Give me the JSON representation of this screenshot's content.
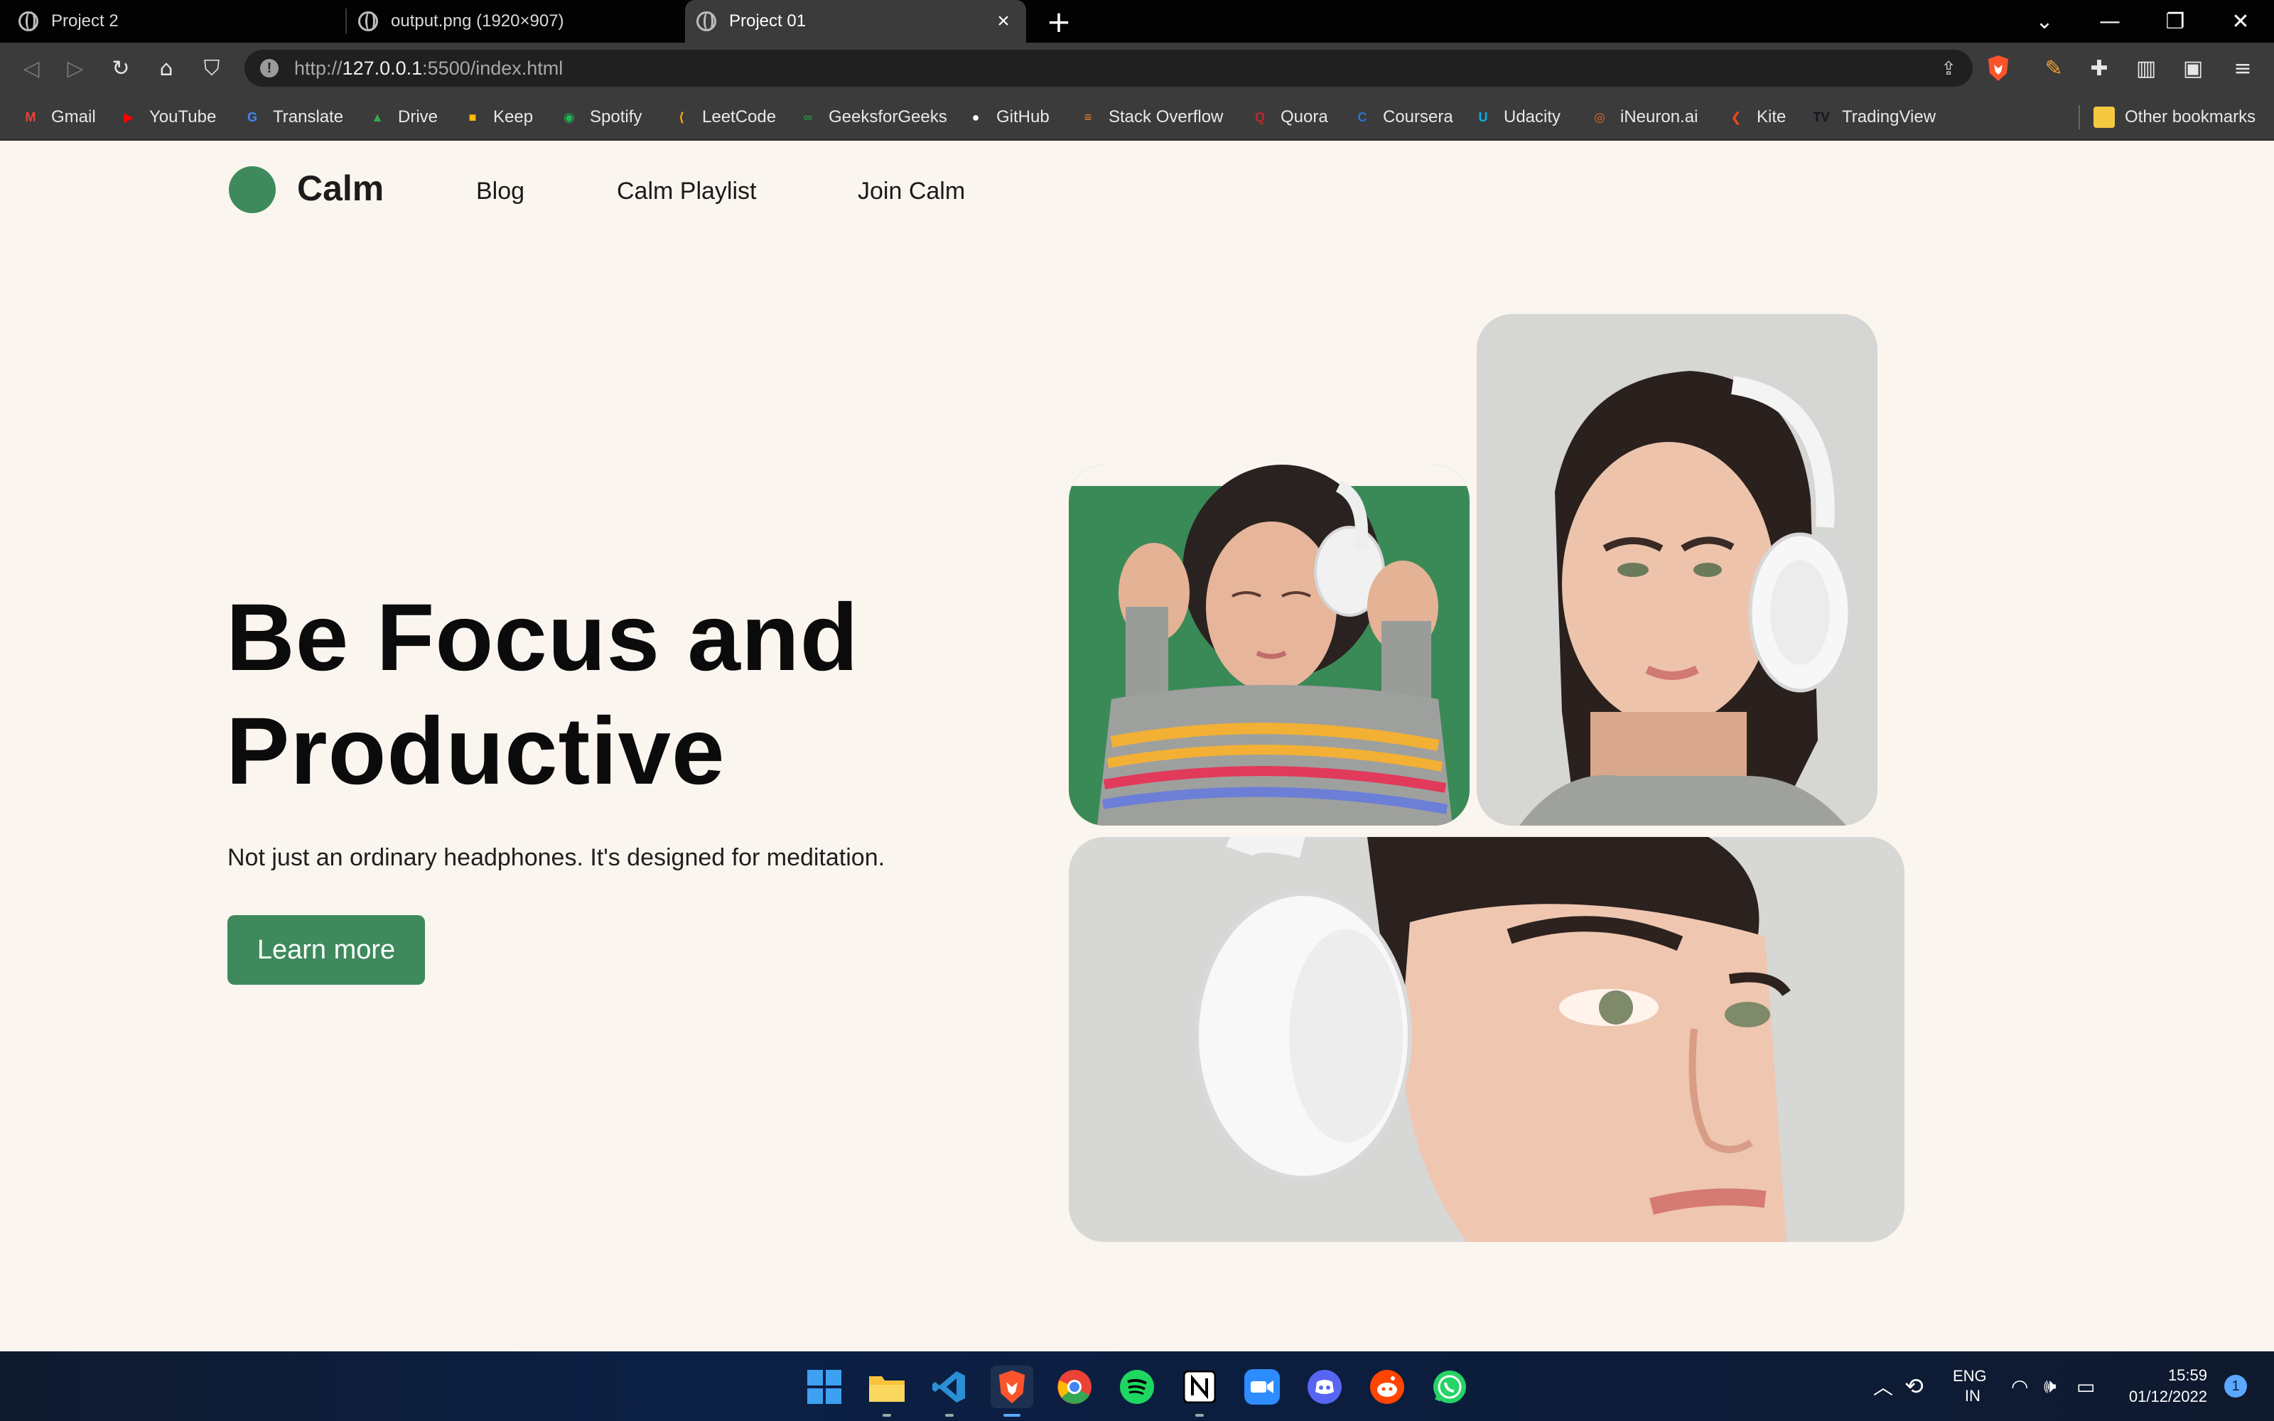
{
  "browser": {
    "tabs": [
      {
        "title": "Project 2",
        "active": false
      },
      {
        "title": "output.png (1920×907)",
        "active": false
      },
      {
        "title": "Project 01",
        "active": true
      }
    ],
    "url_prefix": "http://",
    "url_host": "127.0.0.1",
    "url_rest": ":5500/index.html",
    "bookmarks": [
      {
        "label": "Gmail",
        "icon": "gmail-icon",
        "color": "#ea4335"
      },
      {
        "label": "YouTube",
        "icon": "youtube-icon",
        "color": "#ff0000"
      },
      {
        "label": "Translate",
        "icon": "translate-icon",
        "color": "#4285f4"
      },
      {
        "label": "Drive",
        "icon": "drive-icon",
        "color": "#34a853"
      },
      {
        "label": "Keep",
        "icon": "keep-icon",
        "color": "#fbbc04"
      },
      {
        "label": "Spotify",
        "icon": "spotify-icon",
        "color": "#1db954"
      },
      {
        "label": "LeetCode",
        "icon": "leetcode-icon",
        "color": "#ffa116"
      },
      {
        "label": "GeeksforGeeks",
        "icon": "geeksforgeeks-icon",
        "color": "#2f8d46"
      },
      {
        "label": "GitHub",
        "icon": "github-icon",
        "color": "#ffffff"
      },
      {
        "label": "Stack Overflow",
        "icon": "stackoverflow-icon",
        "color": "#f48024"
      },
      {
        "label": "Quora",
        "icon": "quora-icon",
        "color": "#b92b27"
      },
      {
        "label": "Coursera",
        "icon": "coursera-icon",
        "color": "#2a73cc"
      },
      {
        "label": "Udacity",
        "icon": "udacity-icon",
        "color": "#02b3e4"
      },
      {
        "label": "iNeuron.ai",
        "icon": "ineuron-icon",
        "color": "#f26522"
      },
      {
        "label": "Kite",
        "icon": "kite-icon",
        "color": "#f6461a"
      },
      {
        "label": "TradingView",
        "icon": "tradingview-icon",
        "color": "#131722"
      }
    ],
    "other_bookmarks": "Other bookmarks"
  },
  "site": {
    "logo": "Calm",
    "nav": [
      "Blog",
      "Calm Playlist",
      "Join Calm"
    ],
    "hero_title_line1": "Be Focus and",
    "hero_title_line2": "Productive",
    "hero_subtitle": "Not just an ordinary headphones. It's designed for meditation.",
    "cta": "Learn more",
    "accent": "#3f8a5c",
    "background": "#faf5ee"
  },
  "taskbar": {
    "apps": [
      "windows-start-icon",
      "file-explorer-icon",
      "vscode-icon",
      "brave-icon",
      "chrome-icon",
      "spotify-icon",
      "notion-icon",
      "zoom-icon",
      "discord-icon",
      "reddit-icon",
      "whatsapp-icon"
    ],
    "language_line1": "ENG",
    "language_line2": "IN",
    "time": "15:59",
    "date": "01/12/2022",
    "notification_count": "1"
  }
}
